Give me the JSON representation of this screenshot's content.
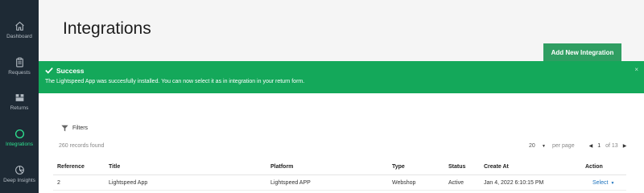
{
  "sidebar": {
    "items": [
      {
        "label": "Dashboard",
        "icon": "home-icon",
        "active": false
      },
      {
        "label": "Requests",
        "icon": "clipboard-icon",
        "active": false
      },
      {
        "label": "Returns",
        "icon": "box-icon",
        "active": false
      },
      {
        "label": "Integrations",
        "icon": "circle-icon",
        "active": true
      },
      {
        "label": "Deep Insights",
        "icon": "pie-chart-icon",
        "active": false
      }
    ]
  },
  "header": {
    "title": "Integrations",
    "add_button_label": "Add New Integration"
  },
  "banner": {
    "title": "Success",
    "message": "The Lightspeed App was succesfully installed. You can now select it as in integration in your return form.",
    "close": "×"
  },
  "toolbar": {
    "filters_label": "Filters",
    "records_found": "260 records found"
  },
  "pagination": {
    "per_page_value": "20",
    "per_page_label": "per page",
    "current_page": "1",
    "of_pages": "of 13"
  },
  "table": {
    "headers": {
      "reference": "Reference",
      "title": "Title",
      "platform": "Platform",
      "type": "Type",
      "status": "Status",
      "created_at": "Create At",
      "action": "Action"
    },
    "rows": [
      {
        "reference": "2",
        "title": "Lightspeed App",
        "platform": "Lightspeed APP",
        "type": "Webshop",
        "status": "Active",
        "created_at": "Jan 4, 2022 6:10:15 PM",
        "action": "Select"
      }
    ]
  },
  "colors": {
    "sidebar_bg": "#1e2a35",
    "active_accent": "#2ee08f",
    "success_banner": "#14a85a",
    "primary_button": "#2f9e62",
    "link": "#1e73be"
  }
}
